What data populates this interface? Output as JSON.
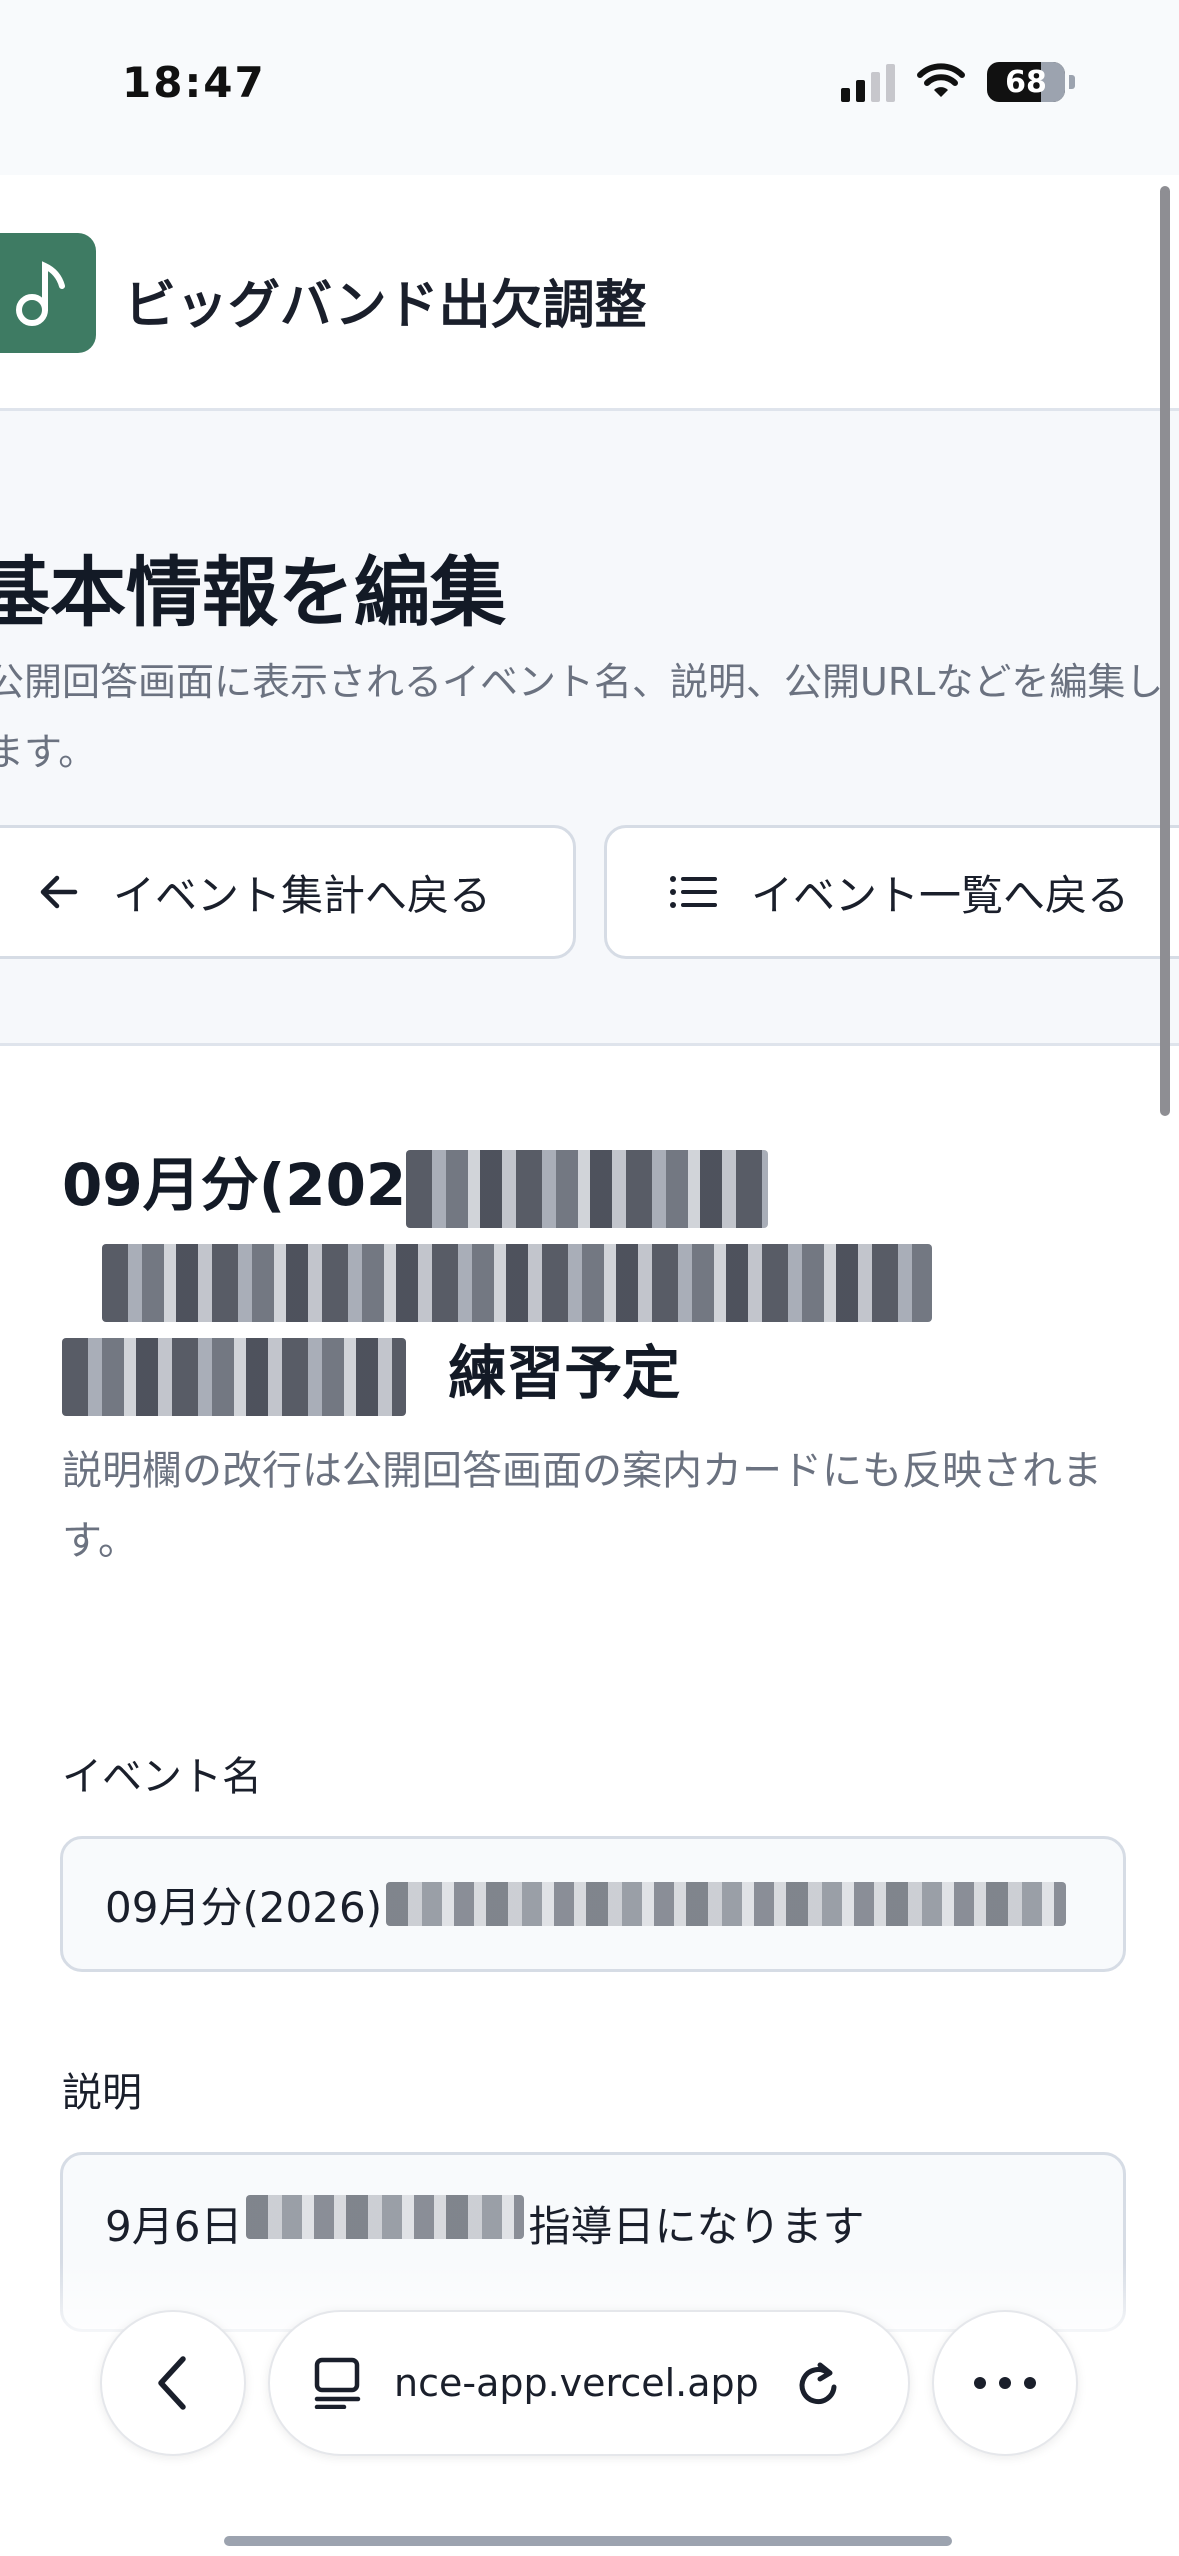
{
  "status_bar": {
    "time": "18:47",
    "battery": "68"
  },
  "app": {
    "title": "ビッグバンド出欠調整"
  },
  "hero": {
    "title": "基本情報を編集",
    "description": "公開回答画面に表示されるイベント名、説明、公開URLなどを編集します。",
    "back_button_label": "イベント集計へ戻る",
    "list_button_label": "イベント一覧へ戻る"
  },
  "event": {
    "title_prefix": "09月分(202",
    "title_suffix": "練習予定",
    "note": "説明欄の改行は公開回答画面の案内カードにも反映されます。"
  },
  "form": {
    "name_label": "イベント名",
    "name_value": "09月分(2026)",
    "description_label": "説明",
    "description_value_prefix": "9月6日",
    "description_value_suffix": "指導日になります"
  },
  "browser": {
    "url": "nce-app.vercel.app"
  }
}
